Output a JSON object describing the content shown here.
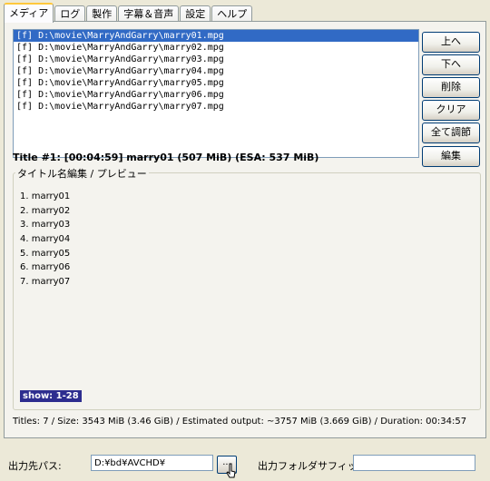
{
  "tabs": [
    "メディア",
    "ログ",
    "製作",
    "字幕＆音声",
    "設定",
    "ヘルプ"
  ],
  "active_tab": 0,
  "files": [
    "[f] D:\\movie\\MarryAndGarry\\marry01.mpg",
    "[f] D:\\movie\\MarryAndGarry\\marry02.mpg",
    "[f] D:\\movie\\MarryAndGarry\\marry03.mpg",
    "[f] D:\\movie\\MarryAndGarry\\marry04.mpg",
    "[f] D:\\movie\\MarryAndGarry\\marry05.mpg",
    "[f] D:\\movie\\MarryAndGarry\\marry06.mpg",
    "[f] D:\\movie\\MarryAndGarry\\marry07.mpg"
  ],
  "selected_file": 0,
  "buttons": {
    "up": "上へ",
    "down": "下へ",
    "delete": "削除",
    "clear": "クリア",
    "adjust_all": "全て調節",
    "edit": "編集"
  },
  "title_info": "Title #1: [00:04:59] marry01 (507 MiB) (ESA: 537 MiB)",
  "preview": {
    "group_label": "タイトル名編集 / プレビュー",
    "items": [
      "1. marry01",
      "2. marry02",
      "3. marry03",
      "4. marry04",
      "5. marry05",
      "6. marry06",
      "7. marry07"
    ],
    "show_badge": "show: 1-28"
  },
  "stats": "Titles: 7 / Size: 3543 MiB (3.46 GiB) / Estimated output: ~3757 MiB (3.669 GiB) / Duration: 00:34:57",
  "bottom": {
    "output_path_label": "出力先パス:",
    "output_path_value": "D:¥bd¥AVCHD¥",
    "browse_label": "...",
    "suffix_label": "出力フォルダサフィックス:",
    "suffix_value": ""
  }
}
